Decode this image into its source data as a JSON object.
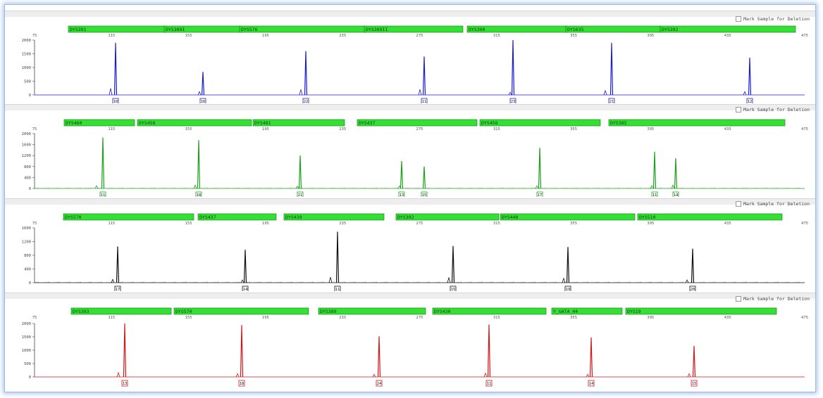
{
  "mark_sample_label": "Mark Sample for Deletion",
  "colors": {
    "blue": "#1c1ccc",
    "green": "#1aa01a",
    "black": "#111111",
    "red": "#d01818",
    "marker_bar": "#33e033"
  },
  "panels": [
    {
      "dye": "blue",
      "x_ticks": [
        "75",
        "115",
        "155",
        "195",
        "235",
        "275",
        "315",
        "355",
        "395",
        "435",
        "475"
      ],
      "y_ticks": [
        "0",
        "500",
        "1000",
        "1500",
        "2000"
      ],
      "ymax": 2000,
      "markers": [
        "DYS391",
        "DYS389I",
        "DYS576",
        "DYS389II",
        "DYS390",
        "DYS635",
        "DYS392"
      ],
      "alleles": [
        "10",
        "16",
        "22",
        "11",
        "23",
        "21",
        "12"
      ]
    },
    {
      "dye": "green",
      "x_ticks": [
        "75",
        "115",
        "155",
        "195",
        "235",
        "275",
        "315",
        "355",
        "395",
        "435",
        "475"
      ],
      "y_ticks": [
        "0",
        "400",
        "800",
        "1200",
        "1600",
        "2000"
      ],
      "ymax": 2000,
      "markers": [
        "DYS460",
        "DYS458",
        "DYS481",
        "DYS437",
        "DYS456",
        "DYS385"
      ],
      "alleles": [
        "11",
        "18",
        "21",
        "13",
        "15",
        "17",
        "11",
        "14"
      ]
    },
    {
      "dye": "black",
      "x_ticks": [
        "75",
        "115",
        "155",
        "195",
        "235",
        "275",
        "315",
        "355",
        "395",
        "435",
        "475"
      ],
      "y_ticks": [
        "0",
        "400",
        "800",
        "1200",
        "1600"
      ],
      "ymax": 1600,
      "markers": [
        "DYS570",
        "DYS437",
        "DYS439",
        "DYS392",
        "DYS448",
        "DYS510"
      ],
      "alleles": [
        "17",
        "14",
        "11",
        "15",
        "19",
        "20"
      ]
    },
    {
      "dye": "red",
      "x_ticks": [
        "75",
        "115",
        "155",
        "195",
        "235",
        "275",
        "315",
        "355",
        "395",
        "435",
        "475"
      ],
      "y_ticks": [
        "0",
        "500",
        "1000",
        "1500",
        "2000"
      ],
      "ymax": 2000,
      "markers": [
        "DYS393",
        "DYS570",
        "DYS389",
        "DYS430",
        "Y_GATA_H4",
        "DYS19"
      ],
      "alleles": [
        "13",
        "18",
        "24",
        "11",
        "14",
        "15"
      ]
    }
  ]
}
